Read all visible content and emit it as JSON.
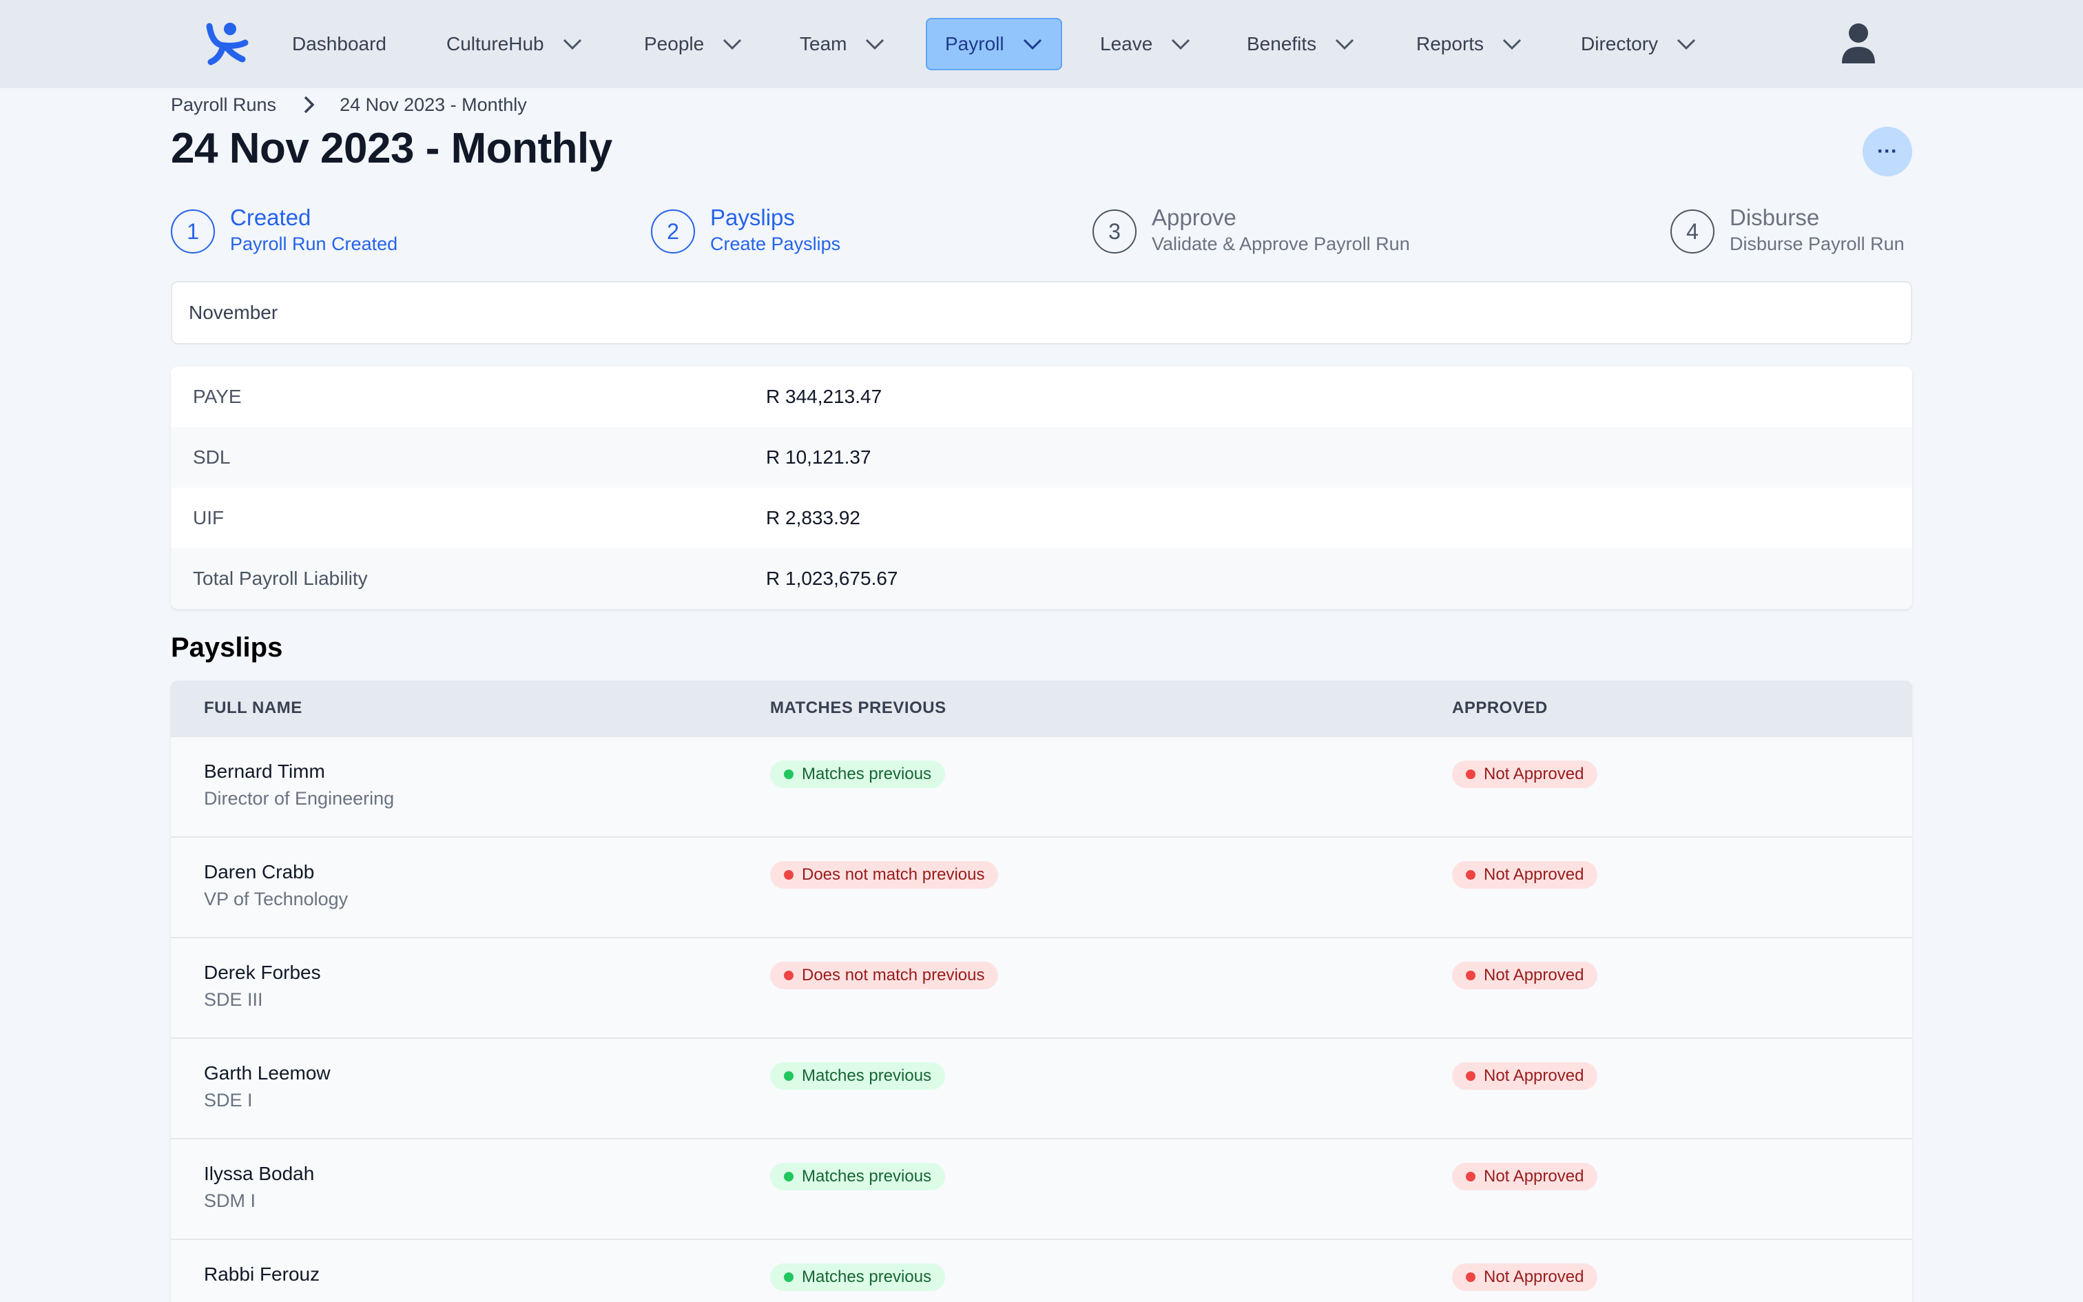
{
  "nav": {
    "items": [
      {
        "label": "Dashboard"
      },
      {
        "label": "CultureHub"
      },
      {
        "label": "People"
      },
      {
        "label": "Team"
      },
      {
        "label": "Payroll"
      },
      {
        "label": "Leave"
      },
      {
        "label": "Benefits"
      },
      {
        "label": "Reports"
      },
      {
        "label": "Directory"
      }
    ],
    "active": "Payroll",
    "accent": "#93c5fd"
  },
  "breadcrumb": {
    "parent": "Payroll Runs",
    "current": "24 Nov 2023 - Monthly"
  },
  "page": {
    "title": "24 Nov 2023 - Monthly",
    "more_label": "···"
  },
  "steps": [
    {
      "num": "1",
      "title": "Created",
      "subtitle": "Payroll Run Created",
      "state": "done"
    },
    {
      "num": "2",
      "title": "Payslips",
      "subtitle": "Create Payslips",
      "state": "done"
    },
    {
      "num": "3",
      "title": "Approve",
      "subtitle": "Validate & Approve Payroll Run",
      "state": "pending"
    },
    {
      "num": "4",
      "title": "Disburse",
      "subtitle": "Disburse Payroll Run",
      "state": "pending"
    }
  ],
  "month_select": {
    "value": "November"
  },
  "summary": [
    {
      "label": "PAYE",
      "value": "R 344,213.47"
    },
    {
      "label": "SDL",
      "value": "R 10,121.37"
    },
    {
      "label": "UIF",
      "value": "R 2,833.92"
    },
    {
      "label": "Total Payroll Liability",
      "value": "R 1,023,675.67"
    }
  ],
  "payslips": {
    "title": "Payslips",
    "columns": [
      "FULL NAME",
      "MATCHES PREVIOUS",
      "APPROVED"
    ],
    "rows": [
      {
        "name": "Bernard Timm",
        "role": "Director of Engineering",
        "match": "Matches previous",
        "match_ok": true,
        "approved": "Not Approved"
      },
      {
        "name": "Daren Crabb",
        "role": "VP of Technology",
        "match": "Does not match previous",
        "match_ok": false,
        "approved": "Not Approved"
      },
      {
        "name": "Derek Forbes",
        "role": "SDE III",
        "match": "Does not match previous",
        "match_ok": false,
        "approved": "Not Approved"
      },
      {
        "name": "Garth Leemow",
        "role": "SDE I",
        "match": "Matches previous",
        "match_ok": true,
        "approved": "Not Approved"
      },
      {
        "name": "Ilyssa Bodah",
        "role": "SDM I",
        "match": "Matches previous",
        "match_ok": true,
        "approved": "Not Approved"
      },
      {
        "name": "Rabbi Ferouz",
        "role": "",
        "match": "Matches previous",
        "match_ok": true,
        "approved": "Not Approved"
      }
    ]
  },
  "icons": {
    "logo": "people-logo-icon",
    "nav_dropdown": "chevron-down-icon",
    "breadcrumb_sep": "chevron-right-icon",
    "user": "user-icon",
    "status_dot": "dot-icon"
  }
}
